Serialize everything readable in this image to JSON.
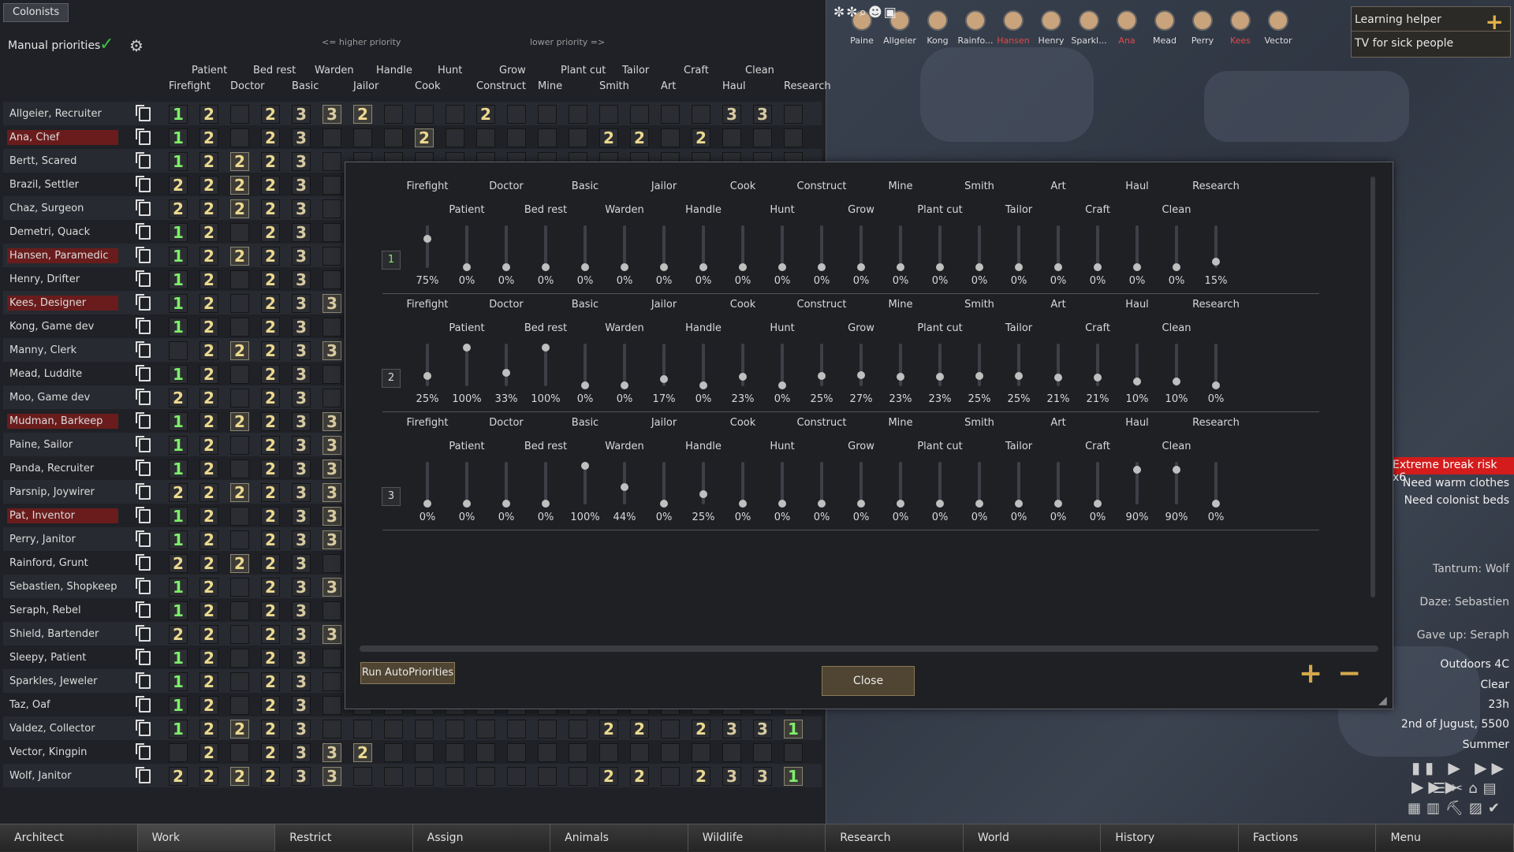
{
  "window_title": "Colonists",
  "manual_priorities_label": "Manual priorities",
  "higher_priority_label": "<= higher priority",
  "lower_priority_label": "lower priority =>",
  "work_columns_top": [
    "Patient",
    "Bed rest",
    "Warden",
    "Handle",
    "Hunt",
    "Grow",
    "Plant cut",
    "Tailor",
    "Craft",
    "Clean"
  ],
  "work_columns_bottom": [
    "Firefight",
    "Doctor",
    "Basic",
    "Jailor",
    "Cook",
    "Construct",
    "Mine",
    "Smith",
    "Art",
    "Haul",
    "Research"
  ],
  "colonists": [
    {
      "name": "Allgeier, Recruiter",
      "warn": false,
      "p": [
        "1",
        "2",
        "",
        "2",
        "3",
        "3",
        "2",
        "",
        "",
        "",
        "2",
        "",
        "",
        "",
        "",
        "",
        "",
        "",
        "3",
        "3",
        ""
      ]
    },
    {
      "name": "Ana, Chef",
      "warn": true,
      "p": [
        "1",
        "2",
        "",
        "2",
        "3",
        "",
        "",
        "",
        "2",
        "",
        "",
        "",
        "",
        "",
        "2",
        "2",
        "",
        "2",
        "",
        "",
        ""
      ]
    },
    {
      "name": "Bertt, Scared",
      "warn": false,
      "p": [
        "1",
        "2",
        "2",
        "2",
        "3",
        "",
        "",
        "",
        "",
        "",
        "",
        "",
        "",
        "",
        "",
        "",
        "",
        "",
        "",
        "",
        ""
      ]
    },
    {
      "name": "Brazil, Settler",
      "warn": false,
      "p": [
        "2",
        "2",
        "2",
        "2",
        "3",
        "",
        "",
        "",
        "",
        "",
        "",
        "",
        "",
        "",
        "",
        "",
        "",
        "",
        "",
        "",
        ""
      ]
    },
    {
      "name": "Chaz, Surgeon",
      "warn": false,
      "p": [
        "2",
        "2",
        "2",
        "2",
        "3",
        "",
        "",
        "",
        "",
        "",
        "",
        "",
        "",
        "",
        "",
        "",
        "",
        "",
        "",
        "",
        ""
      ]
    },
    {
      "name": "Demetri, Quack",
      "warn": false,
      "p": [
        "1",
        "2",
        "",
        "2",
        "3",
        "",
        "",
        "",
        "",
        "",
        "",
        "",
        "",
        "",
        "",
        "",
        "",
        "",
        "",
        "",
        ""
      ]
    },
    {
      "name": "Hansen, Paramedic",
      "warn": true,
      "p": [
        "1",
        "2",
        "2",
        "2",
        "3",
        "",
        "",
        "",
        "",
        "",
        "",
        "",
        "",
        "",
        "",
        "",
        "",
        "",
        "",
        "",
        ""
      ]
    },
    {
      "name": "Henry, Drifter",
      "warn": false,
      "p": [
        "1",
        "2",
        "",
        "2",
        "3",
        "",
        "",
        "",
        "",
        "",
        "",
        "",
        "",
        "",
        "",
        "",
        "",
        "",
        "",
        "",
        ""
      ]
    },
    {
      "name": "Kees, Designer",
      "warn": true,
      "p": [
        "1",
        "2",
        "",
        "2",
        "3",
        "3",
        "",
        "",
        "",
        "",
        "",
        "",
        "",
        "",
        "",
        "",
        "",
        "",
        "",
        "",
        ""
      ]
    },
    {
      "name": "Kong, Game dev",
      "warn": false,
      "p": [
        "1",
        "2",
        "",
        "2",
        "3",
        "",
        "",
        "",
        "",
        "",
        "",
        "",
        "",
        "",
        "",
        "",
        "",
        "",
        "",
        "",
        ""
      ]
    },
    {
      "name": "Manny, Clerk",
      "warn": false,
      "p": [
        "",
        "2",
        "2",
        "2",
        "3",
        "3",
        "",
        "",
        "",
        "",
        "",
        "",
        "",
        "",
        "",
        "",
        "",
        "",
        "",
        "",
        ""
      ]
    },
    {
      "name": "Mead, Luddite",
      "warn": false,
      "p": [
        "1",
        "2",
        "",
        "2",
        "3",
        "",
        "",
        "",
        "",
        "",
        "",
        "",
        "",
        "",
        "",
        "",
        "",
        "",
        "",
        "",
        ""
      ]
    },
    {
      "name": "Moo, Game dev",
      "warn": false,
      "p": [
        "2",
        "2",
        "",
        "2",
        "3",
        "",
        "",
        "",
        "",
        "",
        "",
        "",
        "",
        "",
        "",
        "",
        "",
        "",
        "",
        "",
        ""
      ]
    },
    {
      "name": "Mudman, Barkeep",
      "warn": true,
      "p": [
        "1",
        "2",
        "2",
        "2",
        "3",
        "3",
        "",
        "",
        "",
        "",
        "",
        "",
        "",
        "",
        "",
        "",
        "",
        "",
        "",
        "",
        ""
      ]
    },
    {
      "name": "Paine, Sailor",
      "warn": false,
      "p": [
        "1",
        "2",
        "",
        "2",
        "3",
        "3",
        "",
        "",
        "",
        "",
        "",
        "",
        "",
        "",
        "",
        "",
        "",
        "",
        "",
        "",
        ""
      ]
    },
    {
      "name": "Panda, Recruiter",
      "warn": false,
      "p": [
        "1",
        "2",
        "",
        "2",
        "3",
        "3",
        "",
        "",
        "",
        "",
        "",
        "",
        "",
        "",
        "",
        "",
        "",
        "",
        "",
        "",
        ""
      ]
    },
    {
      "name": "Parsnip, Joywirer",
      "warn": false,
      "p": [
        "2",
        "2",
        "2",
        "2",
        "3",
        "3",
        "",
        "",
        "",
        "",
        "",
        "",
        "",
        "",
        "",
        "",
        "",
        "",
        "",
        "",
        ""
      ]
    },
    {
      "name": "Pat, Inventor",
      "warn": true,
      "p": [
        "1",
        "2",
        "",
        "2",
        "3",
        "3",
        "",
        "",
        "",
        "",
        "",
        "",
        "",
        "",
        "",
        "",
        "",
        "",
        "",
        "",
        ""
      ]
    },
    {
      "name": "Perry, Janitor",
      "warn": false,
      "p": [
        "1",
        "2",
        "",
        "2",
        "3",
        "3",
        "",
        "",
        "",
        "",
        "",
        "",
        "",
        "",
        "",
        "",
        "",
        "",
        "",
        "",
        ""
      ]
    },
    {
      "name": "Rainford, Grunt",
      "warn": false,
      "p": [
        "2",
        "2",
        "2",
        "2",
        "3",
        "",
        "",
        "",
        "",
        "",
        "",
        "",
        "",
        "",
        "",
        "",
        "",
        "",
        "",
        "",
        ""
      ]
    },
    {
      "name": "Sebastien, Shopkeep",
      "warn": false,
      "p": [
        "1",
        "2",
        "",
        "2",
        "3",
        "3",
        "",
        "",
        "",
        "",
        "",
        "",
        "",
        "",
        "",
        "",
        "",
        "",
        "",
        "",
        ""
      ]
    },
    {
      "name": "Seraph, Rebel",
      "warn": false,
      "p": [
        "1",
        "2",
        "",
        "2",
        "3",
        "",
        "",
        "",
        "",
        "",
        "",
        "",
        "",
        "",
        "",
        "",
        "",
        "",
        "",
        "",
        ""
      ]
    },
    {
      "name": "Shield, Bartender",
      "warn": false,
      "p": [
        "2",
        "2",
        "",
        "2",
        "3",
        "3",
        "",
        "",
        "",
        "",
        "",
        "",
        "",
        "",
        "",
        "",
        "",
        "",
        "",
        "",
        ""
      ]
    },
    {
      "name": "Sleepy, Patient",
      "warn": false,
      "p": [
        "1",
        "2",
        "",
        "2",
        "3",
        "",
        "",
        "",
        "",
        "",
        "",
        "",
        "",
        "",
        "",
        "",
        "",
        "",
        "",
        "",
        ""
      ]
    },
    {
      "name": "Sparkles, Jeweler",
      "warn": false,
      "p": [
        "1",
        "2",
        "",
        "2",
        "3",
        "",
        "",
        "",
        "",
        "",
        "",
        "",
        "",
        "",
        "",
        "",
        "",
        "",
        "",
        "",
        ""
      ]
    },
    {
      "name": "Taz, Oaf",
      "warn": false,
      "p": [
        "1",
        "2",
        "",
        "2",
        "3",
        "",
        "",
        "",
        "",
        "",
        "",
        "",
        "",
        "",
        "",
        "",
        "",
        "",
        "",
        "",
        ""
      ]
    },
    {
      "name": "Valdez, Collector",
      "warn": false,
      "p": [
        "1",
        "2",
        "2",
        "2",
        "3",
        "",
        "",
        "",
        "",
        "",
        "",
        "",
        "",
        "",
        "2",
        "2",
        "",
        "2",
        "3",
        "3",
        "1"
      ]
    },
    {
      "name": "Vector, Kingpin",
      "warn": false,
      "p": [
        "",
        "2",
        "",
        "2",
        "3",
        "3",
        "2",
        "",
        "",
        "",
        "",
        "",
        "",
        "",
        "",
        "",
        "",
        "",
        "",
        "",
        ""
      ]
    },
    {
      "name": "Wolf, Janitor",
      "warn": false,
      "p": [
        "2",
        "2",
        "2",
        "2",
        "3",
        "3",
        "",
        "",
        "",
        "",
        "",
        "",
        "",
        "",
        "2",
        "2",
        "",
        "2",
        "3",
        "3",
        "1"
      ]
    }
  ],
  "modal": {
    "top_row": [
      "Firefight",
      "Doctor",
      "Basic",
      "Jailor",
      "Cook",
      "Construct",
      "Mine",
      "Smith",
      "Art",
      "Haul",
      "Research"
    ],
    "bottom_row": [
      "Patient",
      "Bed rest",
      "Warden",
      "Handle",
      "Hunt",
      "Grow",
      "Plant cut",
      "Tailor",
      "Craft",
      "Clean"
    ],
    "priorities": [
      {
        "label": "1",
        "values": [
          75,
          0,
          0,
          0,
          0,
          0,
          0,
          0,
          0,
          0,
          0,
          0,
          0,
          0,
          0,
          0,
          0,
          0,
          0,
          0,
          15
        ]
      },
      {
        "label": "2",
        "values": [
          25,
          100,
          33,
          100,
          0,
          0,
          17,
          0,
          23,
          0,
          25,
          27,
          23,
          23,
          25,
          25,
          21,
          21,
          10,
          10,
          0
        ]
      },
      {
        "label": "3",
        "values": [
          0,
          0,
          0,
          0,
          100,
          44,
          0,
          25,
          0,
          0,
          0,
          0,
          0,
          0,
          0,
          0,
          0,
          0,
          90,
          90,
          0
        ]
      }
    ],
    "run_button": "Run AutoPriorities",
    "close_button": "Close",
    "plus": "+",
    "minus": "−"
  },
  "top_portraits": [
    "Paine",
    "Allgeier",
    "Kong",
    "Rainfo...",
    "Hansen",
    "Henry",
    "Sparkl...",
    "Ana",
    "Mead",
    "Perry",
    "Kees",
    "Vector"
  ],
  "red_portraits": [
    "Hansen",
    "Ana",
    "Kees"
  ],
  "learning_helper": {
    "title": "Learning helper",
    "item": "TV for sick people"
  },
  "alerts": {
    "break_risk": "Extreme break risk x6",
    "warm_clothes": "Need warm clothes",
    "colonist_beds": "Need colonist beds",
    "tantrum": "Tantrum: Wolf",
    "daze": "Daze: Sebastien",
    "gave_up": "Gave up: Seraph"
  },
  "weather": {
    "temp": "Outdoors 4C",
    "sky": "Clear",
    "hour": "23h",
    "date": "2nd of Jugust, 5500",
    "season": "Summer"
  },
  "bottom_tabs": [
    "Architect",
    "Work",
    "Restrict",
    "Assign",
    "Animals",
    "Wildlife",
    "Research",
    "World",
    "History",
    "Factions",
    "Menu"
  ],
  "colors": {
    "green": "#7fef6a",
    "yellow": "#ecd98f",
    "red_alert": "#d41c1c",
    "warn_bg": "#6a1c1c"
  }
}
